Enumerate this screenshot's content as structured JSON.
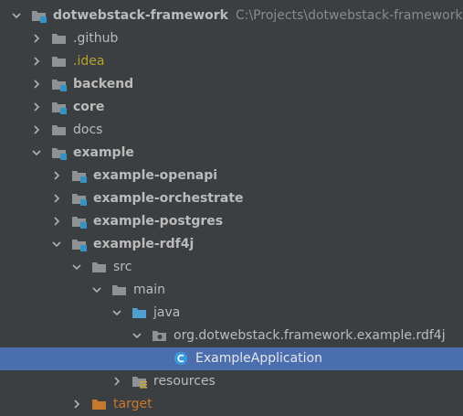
{
  "project_tree": {
    "root": {
      "label": "dotwebstack-framework",
      "path": "C:\\Projects\\dotwebstack-framework"
    },
    "items": [
      {
        "label": ".github"
      },
      {
        "label": ".idea"
      },
      {
        "label": "backend"
      },
      {
        "label": "core"
      },
      {
        "label": "docs"
      },
      {
        "label": "example"
      },
      {
        "label": "example-openapi"
      },
      {
        "label": "example-orchestrate"
      },
      {
        "label": "example-postgres"
      },
      {
        "label": "example-rdf4j"
      },
      {
        "label": "src"
      },
      {
        "label": "main"
      },
      {
        "label": "java"
      },
      {
        "label": "org.dotwebstack.framework.example.rdf4j"
      },
      {
        "label": "ExampleApplication"
      },
      {
        "label": "resources"
      },
      {
        "label": "target"
      }
    ]
  },
  "colors": {
    "background": "#3c3f41",
    "selection": "#4b6eaf",
    "folder": "#8f9294",
    "module_badge": "#3592c4",
    "source_folder": "#4f9fcf",
    "excluded_folder": "#c7782f",
    "class_icon": "#3b9ad9"
  }
}
